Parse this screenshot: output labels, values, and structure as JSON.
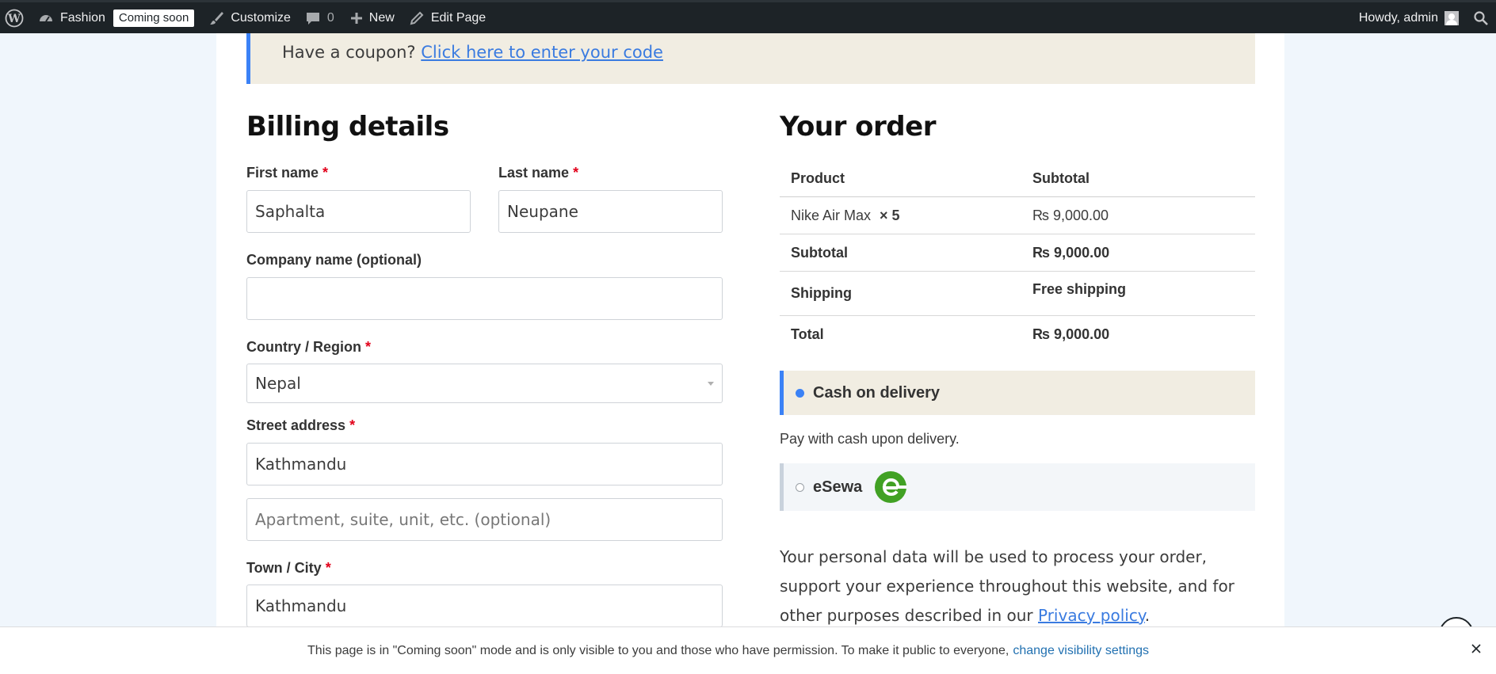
{
  "adminbar": {
    "site_name": "Fashion",
    "coming_soon_badge": "Coming soon",
    "customize": "Customize",
    "comments_count": "0",
    "new": "New",
    "edit_page": "Edit Page",
    "howdy": "Howdy, admin"
  },
  "coupon": {
    "text": "Have a coupon?",
    "link": "Click here to enter your code"
  },
  "billing": {
    "heading": "Billing details",
    "first_name_label": "First name",
    "first_name_value": "Saphalta",
    "last_name_label": "Last name",
    "last_name_value": "Neupane",
    "company_label": "Company name (optional)",
    "company_value": "",
    "country_label": "Country / Region",
    "country_value": "Nepal",
    "street_label": "Street address",
    "street_value": "Kathmandu",
    "apartment_placeholder": "Apartment, suite, unit, etc. (optional)",
    "city_label": "Town / City",
    "city_value": "Kathmandu",
    "required_mark": "*"
  },
  "order": {
    "heading": "Your order",
    "col_product": "Product",
    "col_subtotal": "Subtotal",
    "item_name": "Nike Air Max",
    "item_qty": "× 5",
    "item_total": "₨ 9,000.00",
    "subtotal_label": "Subtotal",
    "subtotal_value": "₨ 9,000.00",
    "shipping_label": "Shipping",
    "shipping_value": "Free shipping",
    "total_label": "Total",
    "total_value": "₨ 9,000.00"
  },
  "payment": {
    "cod_title": "Cash on delivery",
    "cod_desc": "Pay with cash upon delivery.",
    "esewa_title": "eSewa",
    "privacy_text": "Your personal data will be used to process your order, support your experience throughout this website, and for other purposes described in our",
    "privacy_link": "Privacy policy",
    "privacy_end": "."
  },
  "notice": {
    "text": "This page is in \"Coming soon\" mode and is only visible to you and those who have permission. To make it public to everyone,",
    "link": "change visibility settings"
  },
  "colors": {
    "accent": "#3b82f6",
    "admin_bar": "#1d2327",
    "required": "#e2001a",
    "esewa": "#41a124"
  }
}
